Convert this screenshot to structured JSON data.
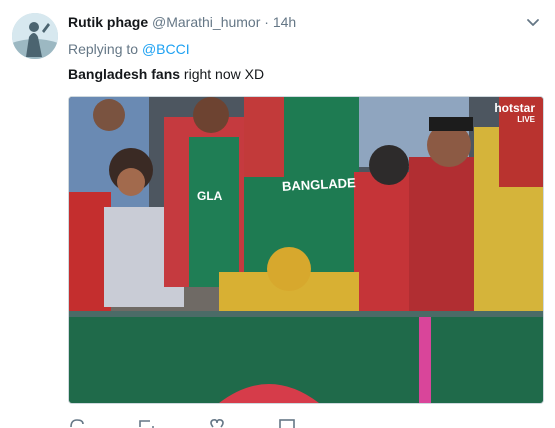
{
  "tweet": {
    "author_name": "Rutik phage",
    "handle": "@Marathi_humor",
    "separator": "·",
    "time": "14h",
    "replying_prefix": "Replying to",
    "replying_to": "@BCCI",
    "text_bold": "Bangladesh fans",
    "text_rest": " right now XD"
  },
  "media": {
    "watermark_brand": "hotstar",
    "watermark_sub": "LIVE",
    "jersey_text": "BANGLADE",
    "jersey_text_2": "GLA"
  },
  "icons": {
    "avatar": "avatar",
    "menu": "chevron-down-icon",
    "actions": [
      "reply-icon",
      "retweet-icon",
      "like-icon",
      "message-icon"
    ]
  },
  "colors": {
    "link": "#1da1f2",
    "muted": "#657786",
    "text": "#14171a"
  }
}
